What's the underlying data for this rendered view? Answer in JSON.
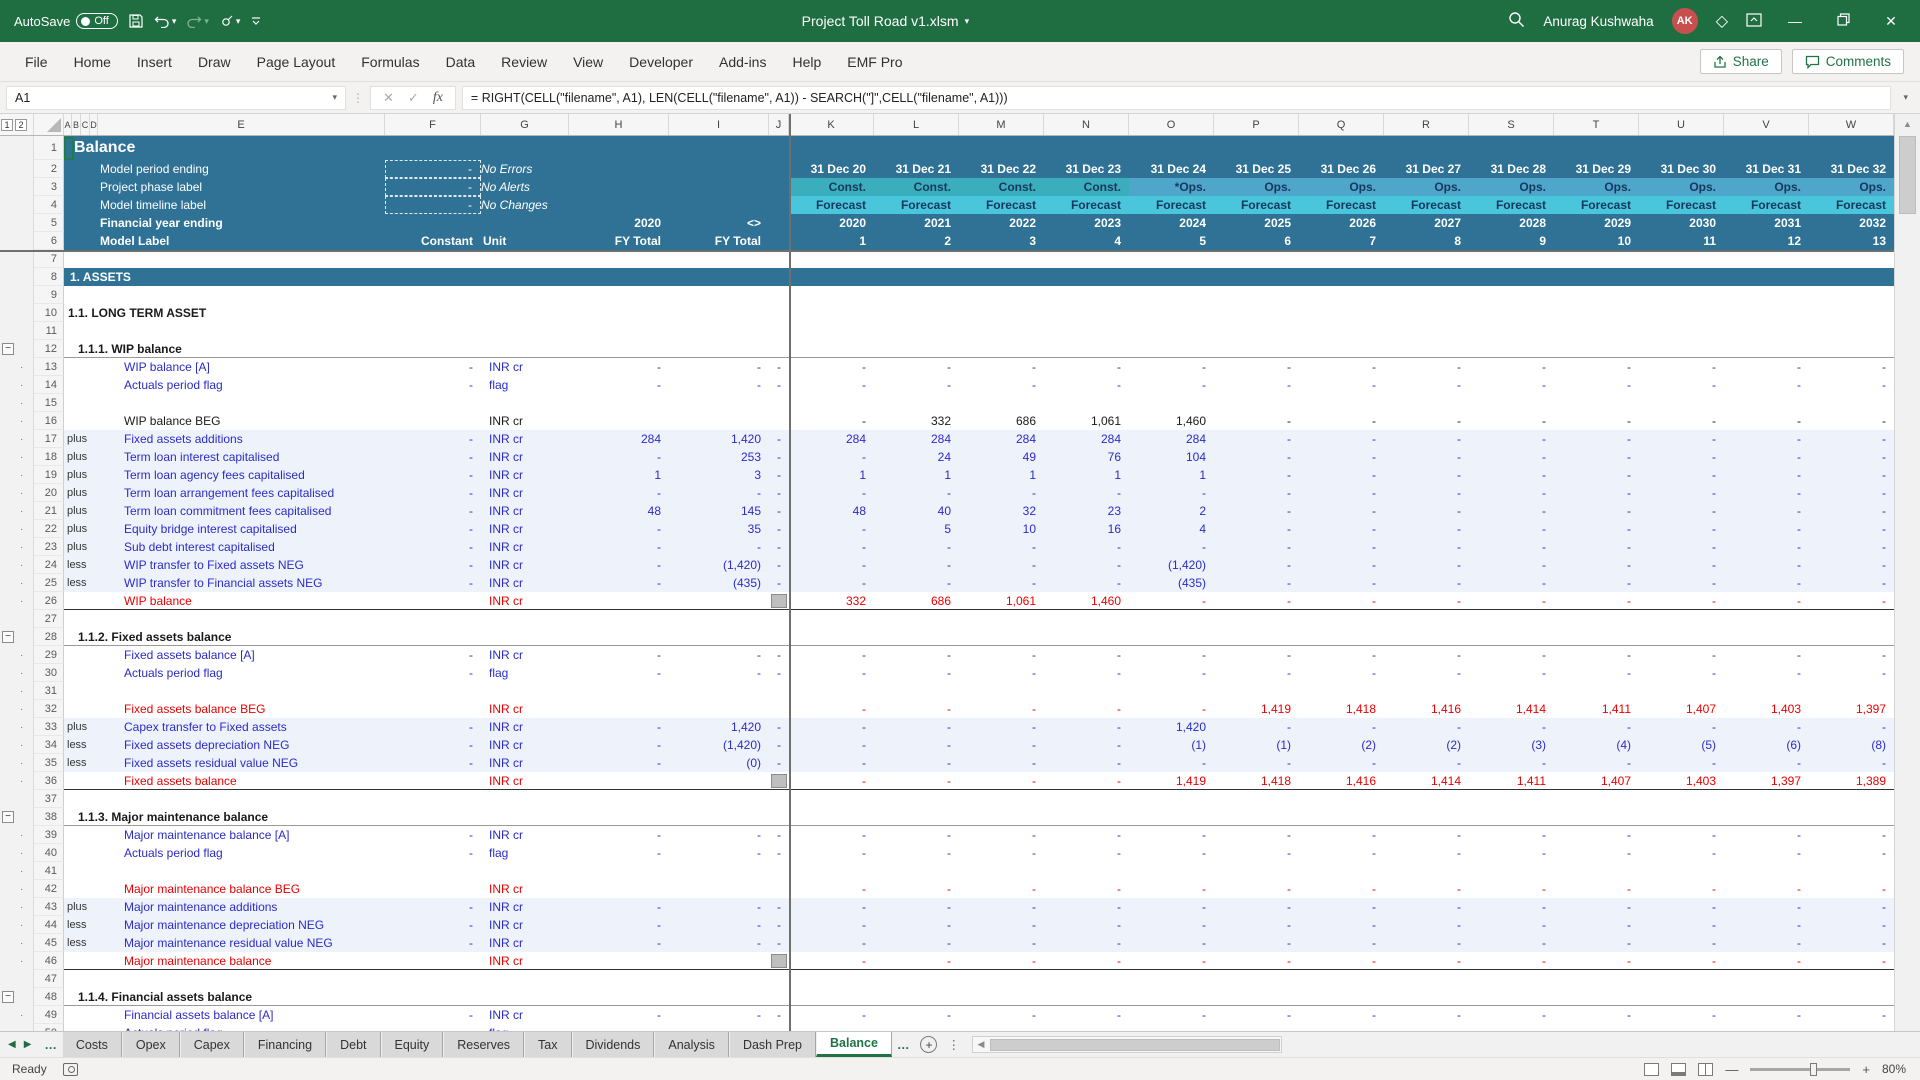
{
  "titlebar": {
    "autosave_label": "AutoSave",
    "autosave_state": "Off",
    "filename": "Project Toll Road v1.xlsm",
    "user_name": "Anurag Kushwaha",
    "avatar_initials": "AK",
    "avatar_color": "#C94F4F",
    "bar_color": "#1E6E42"
  },
  "ribbon": {
    "tabs": [
      "File",
      "Home",
      "Insert",
      "Draw",
      "Page Layout",
      "Formulas",
      "Data",
      "Review",
      "View",
      "Developer",
      "Add-ins",
      "Help",
      "EMF Pro"
    ],
    "share_label": "Share",
    "comments_label": "Comments"
  },
  "formula_bar": {
    "name_box": "A1",
    "formula": "= RIGHT(CELL(\"filename\", A1), LEN(CELL(\"filename\", A1)) - SEARCH(\"]\",CELL(\"filename\", A1)))"
  },
  "grid": {
    "outline_levels": [
      "1",
      "2"
    ],
    "col_letters": [
      "A",
      "B",
      "C",
      "D",
      "E",
      "F",
      "G",
      "H",
      "I",
      "J",
      "K",
      "L",
      "M",
      "N",
      "O",
      "P",
      "Q",
      "R",
      "S",
      "T",
      "U",
      "V",
      "W"
    ],
    "header": {
      "title": "Balance",
      "period_ending": {
        "label": "Model period ending",
        "check": "-",
        "status": "No Errors",
        "dates": [
          "31 Dec 20",
          "31 Dec 21",
          "31 Dec 22",
          "31 Dec 23",
          "31 Dec 24",
          "31 Dec 25",
          "31 Dec 26",
          "31 Dec 27",
          "31 Dec 28",
          "31 Dec 29",
          "31 Dec 30",
          "31 Dec 31",
          "31 Dec 32"
        ]
      },
      "phase": {
        "label": "Project phase label",
        "check": "-",
        "status": "No Alerts",
        "values": [
          "Const.",
          "Const.",
          "Const.",
          "Const.",
          "*Ops.",
          "Ops.",
          "Ops.",
          "Ops.",
          "Ops.",
          "Ops.",
          "Ops.",
          "Ops.",
          "Ops."
        ],
        "const_count": 4
      },
      "timeline": {
        "label": "Model timeline label",
        "check": "-",
        "status": "No Changes",
        "values": [
          "Forecast",
          "Forecast",
          "Forecast",
          "Forecast",
          "Forecast",
          "Forecast",
          "Forecast",
          "Forecast",
          "Forecast",
          "Forecast",
          "Forecast",
          "Forecast",
          "Forecast"
        ]
      },
      "fy": {
        "label": "Financial year ending",
        "fy_total": "2020",
        "sign": "<>",
        "years": [
          "2020",
          "2021",
          "2022",
          "2023",
          "2024",
          "2025",
          "2026",
          "2027",
          "2028",
          "2029",
          "2030",
          "2031",
          "2032"
        ]
      },
      "model_label": {
        "label": "Model Label",
        "constant": "Constant",
        "unit": "Unit",
        "fy_total": "FY Total",
        "fy_total2": "FY Total",
        "numbers": [
          "1",
          "2",
          "3",
          "4",
          "5",
          "6",
          "7",
          "8",
          "9",
          "10",
          "11",
          "12",
          "13"
        ]
      }
    },
    "rows": [
      {
        "n": 7,
        "kind": "blank"
      },
      {
        "n": 8,
        "kind": "banner",
        "label": "1. ASSETS"
      },
      {
        "n": 9,
        "kind": "blank"
      },
      {
        "n": 10,
        "kind": "h1",
        "label": "1.1. LONG TERM ASSET"
      },
      {
        "n": 11,
        "kind": "blank"
      },
      {
        "n": 12,
        "kind": "h2",
        "label": "1.1.1. WIP balance",
        "outline": "minus"
      },
      {
        "n": 13,
        "kind": "item",
        "label": "WIP balance [A]",
        "f": "-",
        "g": "INR cr",
        "h": "-",
        "i": "-",
        "j": "-",
        "outline": "dot",
        "v": [
          "-",
          "-",
          "-",
          "-",
          "-",
          "-",
          "-",
          "-",
          "-",
          "-",
          "-",
          "-",
          "-"
        ]
      },
      {
        "n": 14,
        "kind": "item",
        "label": "Actuals period flag",
        "f": "-",
        "g": "flag",
        "h": "-",
        "i": "-",
        "j": "-",
        "outline": "dot",
        "v": [
          "-",
          "-",
          "-",
          "-",
          "-",
          "-",
          "-",
          "-",
          "-",
          "-",
          "-",
          "-",
          "-"
        ]
      },
      {
        "n": 15,
        "kind": "blank",
        "outline": "dot"
      },
      {
        "n": 16,
        "kind": "calc",
        "label": "WIP balance BEG",
        "g": "INR cr",
        "outline": "dot",
        "v": [
          "-",
          "332",
          "686",
          "1,061",
          "1,460",
          "-",
          "-",
          "-",
          "-",
          "-",
          "-",
          "-",
          "-"
        ]
      },
      {
        "n": 17,
        "kind": "item",
        "tint": true,
        "op": "plus",
        "label": "Fixed assets additions",
        "f": "-",
        "g": "INR cr",
        "h": "284",
        "i": "1,420",
        "j": "-",
        "outline": "dot",
        "v": [
          "284",
          "284",
          "284",
          "284",
          "284",
          "-",
          "-",
          "-",
          "-",
          "-",
          "-",
          "-",
          "-"
        ]
      },
      {
        "n": 18,
        "kind": "item",
        "tint": true,
        "op": "plus",
        "label": "Term loan interest capitalised",
        "f": "-",
        "g": "INR cr",
        "h": "-",
        "i": "253",
        "j": "-",
        "outline": "dot",
        "v": [
          "-",
          "24",
          "49",
          "76",
          "104",
          "-",
          "-",
          "-",
          "-",
          "-",
          "-",
          "-",
          "-"
        ]
      },
      {
        "n": 19,
        "kind": "item",
        "tint": true,
        "op": "plus",
        "label": "Term loan agency fees capitalised",
        "f": "-",
        "g": "INR cr",
        "h": "1",
        "i": "3",
        "j": "-",
        "outline": "dot",
        "v": [
          "1",
          "1",
          "1",
          "1",
          "1",
          "-",
          "-",
          "-",
          "-",
          "-",
          "-",
          "-",
          "-"
        ]
      },
      {
        "n": 20,
        "kind": "item",
        "tint": true,
        "op": "plus",
        "label": "Term loan arrangement fees capitalised",
        "f": "-",
        "g": "INR cr",
        "h": "-",
        "i": "-",
        "j": "-",
        "outline": "dot",
        "v": [
          "-",
          "-",
          "-",
          "-",
          "-",
          "-",
          "-",
          "-",
          "-",
          "-",
          "-",
          "-",
          "-"
        ]
      },
      {
        "n": 21,
        "kind": "item",
        "tint": true,
        "op": "plus",
        "label": "Term loan commitment fees capitalised",
        "f": "-",
        "g": "INR cr",
        "h": "48",
        "i": "145",
        "j": "-",
        "outline": "dot",
        "v": [
          "48",
          "40",
          "32",
          "23",
          "2",
          "-",
          "-",
          "-",
          "-",
          "-",
          "-",
          "-",
          "-"
        ]
      },
      {
        "n": 22,
        "kind": "item",
        "tint": true,
        "op": "plus",
        "label": "Equity bridge interest capitalised",
        "f": "-",
        "g": "INR cr",
        "h": "-",
        "i": "35",
        "j": "-",
        "outline": "dot",
        "v": [
          "-",
          "5",
          "10",
          "16",
          "4",
          "-",
          "-",
          "-",
          "-",
          "-",
          "-",
          "-",
          "-"
        ]
      },
      {
        "n": 23,
        "kind": "item",
        "tint": true,
        "op": "plus",
        "label": "Sub debt interest capitalised",
        "f": "-",
        "g": "INR cr",
        "h": "-",
        "i": "-",
        "j": "-",
        "outline": "dot",
        "v": [
          "-",
          "-",
          "-",
          "-",
          "-",
          "-",
          "-",
          "-",
          "-",
          "-",
          "-",
          "-",
          "-"
        ]
      },
      {
        "n": 24,
        "kind": "item",
        "tint": true,
        "op": "less",
        "label": "WIP transfer to Fixed assets NEG",
        "f": "-",
        "g": "INR cr",
        "h": "-",
        "i": "(1,420)",
        "j": "-",
        "outline": "dot",
        "v": [
          "-",
          "-",
          "-",
          "-",
          "(1,420)",
          "-",
          "-",
          "-",
          "-",
          "-",
          "-",
          "-",
          "-"
        ]
      },
      {
        "n": 25,
        "kind": "item",
        "tint": true,
        "op": "less",
        "label": "WIP transfer to Financial assets NEG",
        "f": "-",
        "g": "INR cr",
        "h": "-",
        "i": "(435)",
        "j": "-",
        "outline": "dot",
        "v": [
          "-",
          "-",
          "-",
          "-",
          "(435)",
          "-",
          "-",
          "-",
          "-",
          "-",
          "-",
          "-",
          "-"
        ]
      },
      {
        "n": 26,
        "kind": "total",
        "label": "WIP balance",
        "g": "INR cr",
        "jbox": true,
        "outline": "dot",
        "v": [
          "332",
          "686",
          "1,061",
          "1,460",
          "-",
          "-",
          "-",
          "-",
          "-",
          "-",
          "-",
          "-",
          "-"
        ]
      },
      {
        "n": 27,
        "kind": "blank"
      },
      {
        "n": 28,
        "kind": "h2",
        "label": "1.1.2. Fixed assets balance",
        "outline": "minus"
      },
      {
        "n": 29,
        "kind": "item",
        "label": "Fixed assets balance [A]",
        "f": "-",
        "g": "INR cr",
        "h": "-",
        "i": "-",
        "j": "-",
        "outline": "dot",
        "v": [
          "-",
          "-",
          "-",
          "-",
          "-",
          "-",
          "-",
          "-",
          "-",
          "-",
          "-",
          "-",
          "-"
        ]
      },
      {
        "n": 30,
        "kind": "item",
        "label": "Actuals period flag",
        "f": "-",
        "g": "flag",
        "h": "-",
        "i": "-",
        "j": "-",
        "outline": "dot",
        "v": [
          "-",
          "-",
          "-",
          "-",
          "-",
          "-",
          "-",
          "-",
          "-",
          "-",
          "-",
          "-",
          "-"
        ]
      },
      {
        "n": 31,
        "kind": "blank",
        "outline": "dot"
      },
      {
        "n": 32,
        "kind": "redcalc",
        "label": "Fixed assets balance BEG",
        "g": "INR cr",
        "outline": "dot",
        "v": [
          "-",
          "-",
          "-",
          "-",
          "-",
          "1,419",
          "1,418",
          "1,416",
          "1,414",
          "1,411",
          "1,407",
          "1,403",
          "1,397"
        ]
      },
      {
        "n": 33,
        "kind": "item",
        "tint": true,
        "op": "plus",
        "label": "Capex transfer to Fixed assets",
        "f": "-",
        "g": "INR cr",
        "h": "-",
        "i": "1,420",
        "j": "-",
        "outline": "dot",
        "v": [
          "-",
          "-",
          "-",
          "-",
          "1,420",
          "-",
          "-",
          "-",
          "-",
          "-",
          "-",
          "-",
          "-"
        ]
      },
      {
        "n": 34,
        "kind": "item",
        "tint": true,
        "op": "less",
        "label": "Fixed assets depreciation NEG",
        "f": "-",
        "g": "INR cr",
        "h": "-",
        "i": "(1,420)",
        "j": "-",
        "outline": "dot",
        "v": [
          "-",
          "-",
          "-",
          "-",
          "(1)",
          "(1)",
          "(2)",
          "(2)",
          "(3)",
          "(4)",
          "(5)",
          "(6)",
          "(8)"
        ]
      },
      {
        "n": 35,
        "kind": "item",
        "tint": true,
        "op": "less",
        "label": "Fixed assets residual value NEG",
        "f": "-",
        "g": "INR cr",
        "h": "-",
        "i": "(0)",
        "j": "-",
        "outline": "dot",
        "v": [
          "-",
          "-",
          "-",
          "-",
          "-",
          "-",
          "-",
          "-",
          "-",
          "-",
          "-",
          "-",
          "-"
        ]
      },
      {
        "n": 36,
        "kind": "total",
        "label": "Fixed assets balance",
        "g": "INR cr",
        "jbox": true,
        "outline": "dot",
        "v": [
          "-",
          "-",
          "-",
          "-",
          "1,419",
          "1,418",
          "1,416",
          "1,414",
          "1,411",
          "1,407",
          "1,403",
          "1,397",
          "1,389"
        ]
      },
      {
        "n": 37,
        "kind": "blank"
      },
      {
        "n": 38,
        "kind": "h2",
        "label": "1.1.3. Major maintenance balance",
        "outline": "minus"
      },
      {
        "n": 39,
        "kind": "item",
        "label": "Major maintenance balance [A]",
        "f": "-",
        "g": "INR cr",
        "h": "-",
        "i": "-",
        "j": "-",
        "outline": "dot",
        "v": [
          "-",
          "-",
          "-",
          "-",
          "-",
          "-",
          "-",
          "-",
          "-",
          "-",
          "-",
          "-",
          "-"
        ]
      },
      {
        "n": 40,
        "kind": "item",
        "label": "Actuals period flag",
        "f": "-",
        "g": "flag",
        "h": "-",
        "i": "-",
        "j": "-",
        "outline": "dot",
        "v": [
          "-",
          "-",
          "-",
          "-",
          "-",
          "-",
          "-",
          "-",
          "-",
          "-",
          "-",
          "-",
          "-"
        ]
      },
      {
        "n": 41,
        "kind": "blank",
        "outline": "dot"
      },
      {
        "n": 42,
        "kind": "redcalc",
        "label": "Major maintenance balance BEG",
        "g": "INR cr",
        "outline": "dot",
        "v": [
          "-",
          "-",
          "-",
          "-",
          "-",
          "-",
          "-",
          "-",
          "-",
          "-",
          "-",
          "-",
          "-"
        ]
      },
      {
        "n": 43,
        "kind": "item",
        "tint": true,
        "op": "plus",
        "label": "Major maintenance additions",
        "f": "-",
        "g": "INR cr",
        "h": "-",
        "i": "-",
        "j": "-",
        "outline": "dot",
        "v": [
          "-",
          "-",
          "-",
          "-",
          "-",
          "-",
          "-",
          "-",
          "-",
          "-",
          "-",
          "-",
          "-"
        ]
      },
      {
        "n": 44,
        "kind": "item",
        "tint": true,
        "op": "less",
        "label": "Major maintenance depreciation NEG",
        "f": "-",
        "g": "INR cr",
        "h": "-",
        "i": "-",
        "j": "-",
        "outline": "dot",
        "v": [
          "-",
          "-",
          "-",
          "-",
          "-",
          "-",
          "-",
          "-",
          "-",
          "-",
          "-",
          "-",
          "-"
        ]
      },
      {
        "n": 45,
        "kind": "item",
        "tint": true,
        "op": "less",
        "label": "Major maintenance residual value NEG",
        "f": "-",
        "g": "INR cr",
        "h": "-",
        "i": "-",
        "j": "-",
        "outline": "dot",
        "v": [
          "-",
          "-",
          "-",
          "-",
          "-",
          "-",
          "-",
          "-",
          "-",
          "-",
          "-",
          "-",
          "-"
        ]
      },
      {
        "n": 46,
        "kind": "total",
        "label": "Major maintenance balance",
        "g": "INR cr",
        "jbox": true,
        "outline": "dot",
        "v": [
          "-",
          "-",
          "-",
          "-",
          "-",
          "-",
          "-",
          "-",
          "-",
          "-",
          "-",
          "-",
          "-"
        ]
      },
      {
        "n": 47,
        "kind": "blank"
      },
      {
        "n": 48,
        "kind": "h2",
        "label": "1.1.4. Financial assets balance",
        "outline": "minus"
      },
      {
        "n": 49,
        "kind": "item",
        "label": "Financial assets balance [A]",
        "f": "-",
        "g": "INR cr",
        "h": "-",
        "i": "-",
        "j": "-",
        "outline": "dot",
        "v": [
          "-",
          "-",
          "-",
          "-",
          "-",
          "-",
          "-",
          "-",
          "-",
          "-",
          "-",
          "-",
          "-"
        ]
      },
      {
        "n": 50,
        "kind": "item",
        "label": "Actuals period flag",
        "f": "-",
        "g": "flag",
        "h": "-",
        "i": "-",
        "j": "-",
        "outline": "dot",
        "v": [
          "-",
          "-",
          "-",
          "-",
          "-",
          "-",
          "-",
          "-",
          "-",
          "-",
          "-",
          "-",
          "-"
        ]
      }
    ]
  },
  "tabbar": {
    "overflow_left": "…",
    "overflow_right": "…",
    "tabs": [
      "Costs",
      "Opex",
      "Capex",
      "Financing",
      "Debt",
      "Equity",
      "Reserves",
      "Tax",
      "Dividends",
      "Analysis",
      "Dash Prep",
      "Balance"
    ],
    "active_tab": "Balance"
  },
  "statusbar": {
    "mode": "Ready",
    "zoom_level": "80%"
  }
}
